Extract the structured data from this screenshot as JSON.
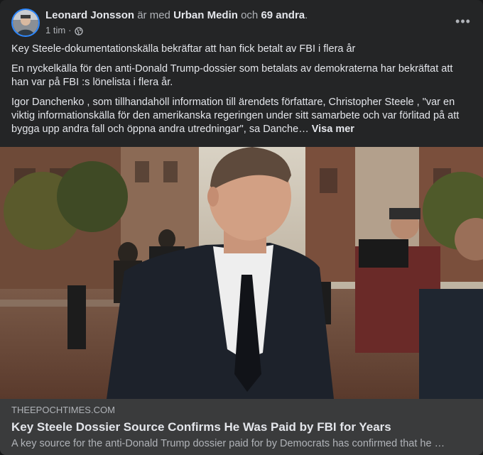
{
  "post": {
    "author": "Leonard Jonsson",
    "with_word": "är med",
    "tagged_person": "Urban Medin",
    "and_word": "och",
    "others": "69 andra",
    "end_punct": ".",
    "time": "1 tim",
    "dot_sep": "·",
    "audience_icon": "globe-icon",
    "more_icon": "more-horizontal-icon",
    "more_label": "•••",
    "paragraphs": [
      "Key Steele-dokumentationskälla bekräftar att han fick betalt av FBI i flera år",
      "En nyckelkälla för den anti-Donald Trump-dossier som betalats av demokraterna har bekräftat att han var på FBI :s lönelista i flera år.",
      "Igor Danchenko , som tillhandahöll information till ärendets författare, Christopher Steele , \"var en viktig informationskälla för den amerikanska regeringen under sitt samarbete och var förlitad på att bygga upp andra fall och öppna andra utredningar\", sa Danche…"
    ],
    "see_more": "Visa mer"
  },
  "link": {
    "domain": "THEEPOCHTIMES.COM",
    "title": "Key Steele Dossier Source Confirms He Was Paid by FBI for Years",
    "description": "A key source for the anti-Donald Trump dossier paid for by Democrats has confirmed that he …"
  },
  "colors": {
    "background": "#242526",
    "card": "#3a3b3c",
    "text_primary": "#e4e6eb",
    "text_secondary": "#b0b3b8",
    "avatar_ring": "#2d88ff"
  }
}
